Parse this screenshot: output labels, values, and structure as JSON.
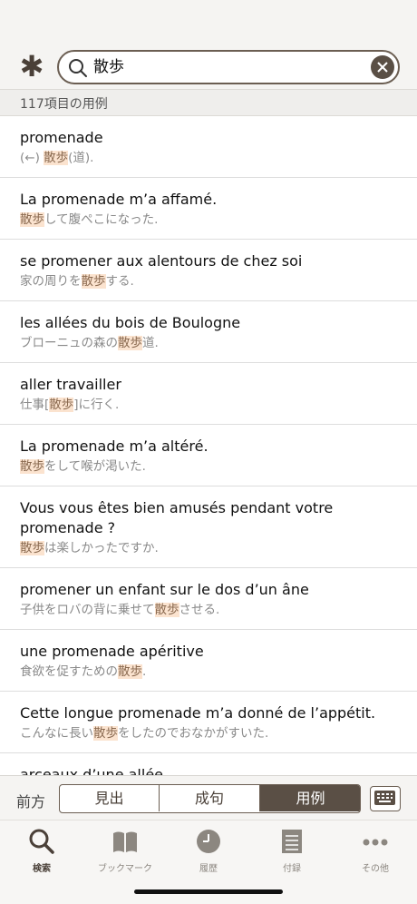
{
  "search": {
    "query": "散歩"
  },
  "result_count": "117項目の用例",
  "entries": [
    {
      "fr": "promenade",
      "ja": [
        {
          "t": "(←) "
        },
        {
          "t": "散歩",
          "hl": true
        },
        {
          "t": "(道)."
        }
      ]
    },
    {
      "fr": "La promenade m’a affamé.",
      "ja": [
        {
          "t": "散歩",
          "hl": true
        },
        {
          "t": "して腹ぺこになった."
        }
      ]
    },
    {
      "fr": "se promener aux alentours de chez soi",
      "ja": [
        {
          "t": "家の周りを"
        },
        {
          "t": "散歩",
          "hl": true
        },
        {
          "t": "する."
        }
      ]
    },
    {
      "fr": "les allées du bois de Boulogne",
      "ja": [
        {
          "t": "ブローニュの森の"
        },
        {
          "t": "散歩",
          "hl": true
        },
        {
          "t": "道."
        }
      ]
    },
    {
      "fr": "aller travailler",
      "ja": [
        {
          "t": "仕事["
        },
        {
          "t": "散歩",
          "hl": true
        },
        {
          "t": "]に行く."
        }
      ]
    },
    {
      "fr": "La promenade m’a altéré.",
      "ja": [
        {
          "t": "散歩",
          "hl": true
        },
        {
          "t": "をして喉が渇いた."
        }
      ]
    },
    {
      "fr": "Vous vous êtes bien amusés pendant votre promenade ?",
      "ja": [
        {
          "t": "散歩",
          "hl": true
        },
        {
          "t": "は楽しかったですか."
        }
      ]
    },
    {
      "fr": "promener un enfant sur le dos d’un âne",
      "ja": [
        {
          "t": "子供をロバの背に乗せて"
        },
        {
          "t": "散歩",
          "hl": true
        },
        {
          "t": "させる."
        }
      ]
    },
    {
      "fr": "une promenade apéritive",
      "ja": [
        {
          "t": "食欲を促すための"
        },
        {
          "t": "散歩",
          "hl": true
        },
        {
          "t": "."
        }
      ]
    },
    {
      "fr": "Cette longue promenade m’a donné de l’appétit.",
      "ja": [
        {
          "t": "こんなに長い"
        },
        {
          "t": "散歩",
          "hl": true
        },
        {
          "t": "をしたのでおなかがすいた."
        }
      ]
    },
    {
      "fr": "arceaux d’une allée",
      "ja": []
    }
  ],
  "bottom_tabs": {
    "prefix_label": "前方",
    "segments": [
      "見出",
      "成句",
      "用例"
    ],
    "selected": "用例"
  },
  "tabbar": [
    {
      "label": "検索",
      "icon": "search-icon",
      "active": true
    },
    {
      "label": "ブックマーク",
      "icon": "book-icon",
      "active": false
    },
    {
      "label": "履歴",
      "icon": "clock-icon",
      "active": false
    },
    {
      "label": "付録",
      "icon": "document-icon",
      "active": false
    },
    {
      "label": "その他",
      "icon": "more-icon",
      "active": false
    }
  ],
  "colors": {
    "accent": "#5a4f45",
    "highlight": "#fbe3cf"
  }
}
